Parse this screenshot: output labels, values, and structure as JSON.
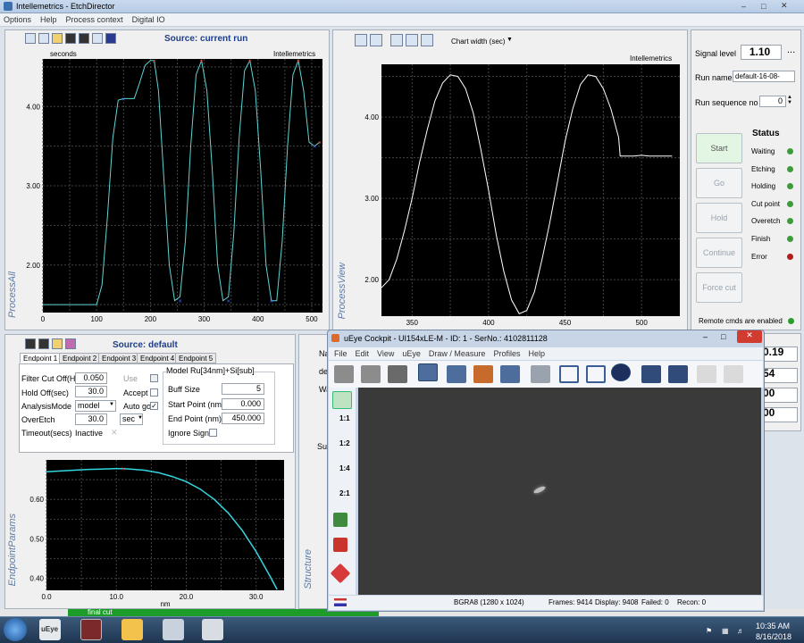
{
  "window": {
    "title": "Intellemetrics - EtchDirector"
  },
  "menu": [
    "Options",
    "Help",
    "Process context",
    "Digital IO"
  ],
  "process_all": {
    "source": "Source: current run",
    "units": "seconds",
    "brand": "Intellemetrics",
    "vlabel": "ProcessAll",
    "chart_data": {
      "type": "line",
      "x": [
        0,
        20,
        40,
        60,
        80,
        100,
        110,
        120,
        130,
        140,
        150,
        160,
        170,
        180,
        190,
        200,
        207,
        215,
        225,
        235,
        245,
        255,
        265,
        275,
        285,
        295,
        305,
        315,
        325,
        335,
        345,
        355,
        365,
        375,
        385,
        395,
        405,
        415,
        425,
        435,
        445,
        455,
        465,
        475,
        485,
        495,
        505,
        515
      ],
      "y": [
        1.5,
        1.5,
        1.5,
        1.5,
        1.5,
        1.5,
        1.75,
        2.6,
        3.6,
        4.08,
        4.1,
        4.1,
        4.1,
        4.3,
        4.52,
        4.58,
        4.58,
        4.2,
        3.1,
        2.0,
        1.55,
        1.6,
        2.3,
        3.5,
        4.4,
        4.58,
        4.2,
        3.2,
        2.0,
        1.55,
        1.6,
        2.4,
        3.6,
        4.45,
        4.58,
        4.2,
        3.2,
        2.0,
        1.55,
        1.55,
        2.3,
        3.5,
        4.4,
        4.58,
        4.2,
        3.55,
        3.5,
        3.55
      ],
      "xticks": [
        "0",
        "100",
        "200",
        "300",
        "400",
        "500"
      ],
      "yticks": [
        "2.00",
        "3.00",
        "4.00"
      ],
      "xlim": [
        0,
        520
      ],
      "ylim": [
        1.4,
        4.6
      ]
    }
  },
  "process_view": {
    "chart_width_label": "Chart width (sec)",
    "brand": "Intellemetrics",
    "vlabel": "ProcessView",
    "chart_data": {
      "type": "line",
      "x": [
        330,
        335,
        340,
        345,
        350,
        355,
        360,
        365,
        370,
        375,
        380,
        385,
        390,
        395,
        400,
        405,
        410,
        415,
        420,
        425,
        430,
        435,
        440,
        445,
        450,
        455,
        460,
        465,
        470,
        475,
        480,
        485,
        486,
        490,
        495,
        500,
        505,
        510,
        515,
        520
      ],
      "y": [
        1.9,
        2.0,
        2.25,
        2.6,
        3.0,
        3.45,
        3.85,
        4.2,
        4.42,
        4.52,
        4.5,
        4.35,
        4.05,
        3.6,
        3.1,
        2.55,
        2.1,
        1.75,
        1.58,
        1.62,
        1.85,
        2.25,
        2.7,
        3.2,
        3.7,
        4.1,
        4.4,
        4.52,
        4.5,
        4.35,
        4.1,
        3.75,
        3.52,
        3.52,
        3.52,
        3.53,
        3.52,
        3.52,
        3.52,
        3.52
      ],
      "xticks": [
        "350",
        "400",
        "450",
        "500"
      ],
      "yticks": [
        "2.00",
        "3.00",
        "4.00"
      ],
      "xlim": [
        330,
        525
      ],
      "ylim": [
        1.55,
        4.65
      ]
    }
  },
  "side": {
    "signal_level_label": "Signal level",
    "signal_level": "1.10",
    "run_name_label": "Run name",
    "run_name": "default-16-08-18_1(",
    "run_seq_label": "Run sequence no",
    "run_seq": "0",
    "status_title": "Status",
    "buttons": [
      "Start",
      "Go",
      "Hold",
      "Continue",
      "Force cut"
    ],
    "statuses": [
      "Waiting",
      "Etching",
      "Holding",
      "Cut point",
      "Overetch",
      "Finish",
      "Error"
    ],
    "remote": "Remote cmds are enabled",
    "values": [
      "0.19",
      "54",
      "00",
      "00"
    ],
    "more": "..."
  },
  "endpoint": {
    "source": "Source: default",
    "tabs": [
      "Endpoint 1",
      "Endpoint 2",
      "Endpoint 3",
      "Endpoint 4",
      "Endpoint 5"
    ],
    "filter_label": "Filter Cut Off(Hz)",
    "filter": "0.050",
    "hold_label": "Hold Off(sec)",
    "hold": "30.0",
    "mode_label": "AnalysisMode",
    "mode": "model",
    "overetch_label": "OverEtch",
    "overetch": "30.0",
    "overetch_unit": "sec",
    "timeout_label": "Timeout(secs)",
    "timeout": "Inactive",
    "use": "Use",
    "accept": "Accept",
    "autogo": "Auto go",
    "model_title": "Model Ru[34nm]+Si[sub]",
    "buff_label": "Buff Size",
    "buff": "5",
    "start_label": "Start Point (nm)",
    "start": "0.000",
    "end_label": "End Point (nm)",
    "end": "450.000",
    "ignore": "Ignore Sign",
    "vlabel": "EndpointParams",
    "xlabel": "nm",
    "chart_data": {
      "type": "line",
      "x": [
        0,
        2,
        4,
        6,
        8,
        10,
        11,
        12,
        14,
        16,
        18,
        20,
        22,
        24,
        26,
        28,
        30,
        32,
        33
      ],
      "y": [
        0.67,
        0.672,
        0.674,
        0.676,
        0.677,
        0.678,
        0.678,
        0.677,
        0.674,
        0.668,
        0.658,
        0.645,
        0.626,
        0.6,
        0.566,
        0.522,
        0.468,
        0.405,
        0.372
      ],
      "xticks": [
        "0.0",
        "10.0",
        "20.0",
        "30.0"
      ],
      "yticks": [
        "0.40",
        "0.50",
        "0.60"
      ],
      "xlim": [
        0,
        34
      ],
      "ylim": [
        0.37,
        0.7
      ]
    }
  },
  "structure": {
    "vlabel": "Structure",
    "partial": [
      "Na",
      "de",
      "Wa",
      "Sub"
    ]
  },
  "status_bar": {
    "final_cut": "final cut"
  },
  "ueye": {
    "title": "uEye Cockpit - UI154xLE-M - ID: 1 - SerNo.: 4102811128",
    "menu": [
      "File",
      "Edit",
      "View",
      "uEye",
      "Draw / Measure",
      "Profiles",
      "Help"
    ],
    "zoom_labels": [
      "1:1",
      "1:2",
      "1:4",
      "2:1"
    ],
    "status": {
      "format": "BGRA8 (1280 x 1024)",
      "frames": "Frames: 9414",
      "display": "Display: 9408",
      "failed": "Failed: 0",
      "recon": "Recon: 0"
    }
  },
  "taskbar": {
    "time": "10:35 AM",
    "date": "8/16/2018",
    "ueye_label": "uEye"
  }
}
